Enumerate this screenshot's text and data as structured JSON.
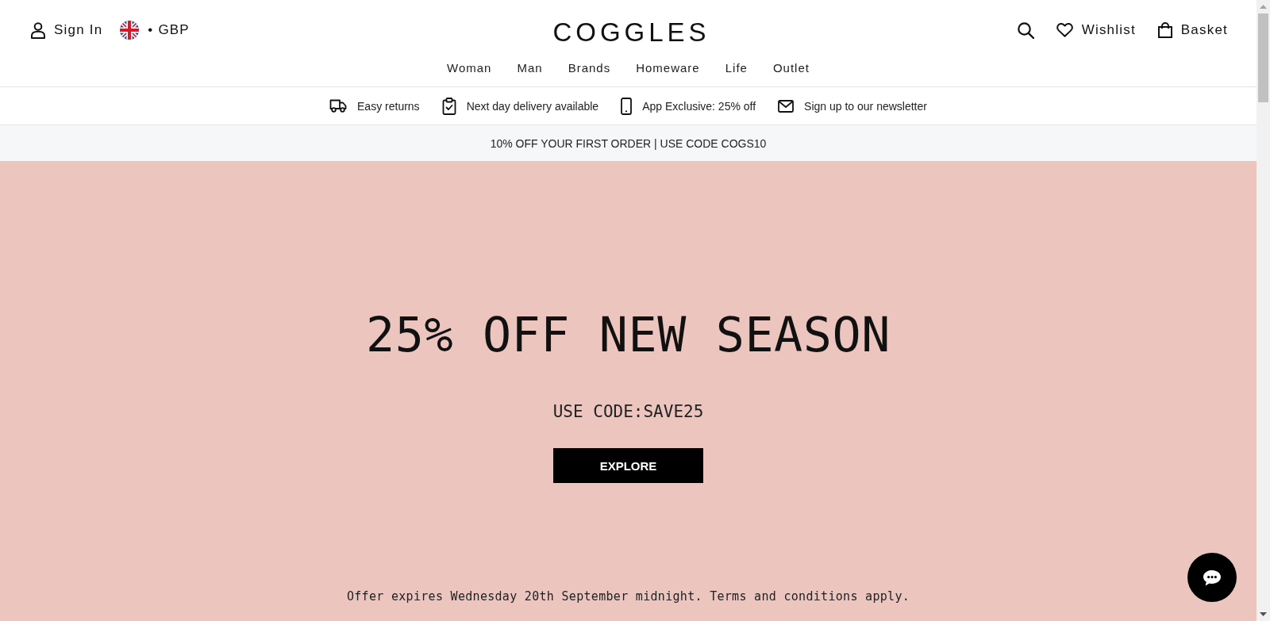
{
  "header": {
    "account_link": "Sign In",
    "currency": "• GBP",
    "logo": "COGGLES",
    "wishlist_link": "Wishlist",
    "basket_link": "Basket"
  },
  "nav": [
    "Woman",
    "Man",
    "Brands",
    "Homeware",
    "Life",
    "Outlet"
  ],
  "benefits": [
    {
      "kind": "returns",
      "label": "Easy returns"
    },
    {
      "kind": "delivery",
      "label": "Next day delivery available"
    },
    {
      "kind": "app",
      "label": "App Exclusive: 25% off"
    },
    {
      "kind": "newsletter",
      "label": "Sign up to our newsletter"
    }
  ],
  "promo_bar": {
    "text": "10% OFF YOUR FIRST ORDER | USE CODE COGS10"
  },
  "hero": {
    "title": "25% OFF NEW SEASON",
    "code": "USE CODE:SAVE25",
    "button": "EXPLORE",
    "terms": "Offer expires Wednesday 20th September midnight. Terms and conditions apply."
  }
}
